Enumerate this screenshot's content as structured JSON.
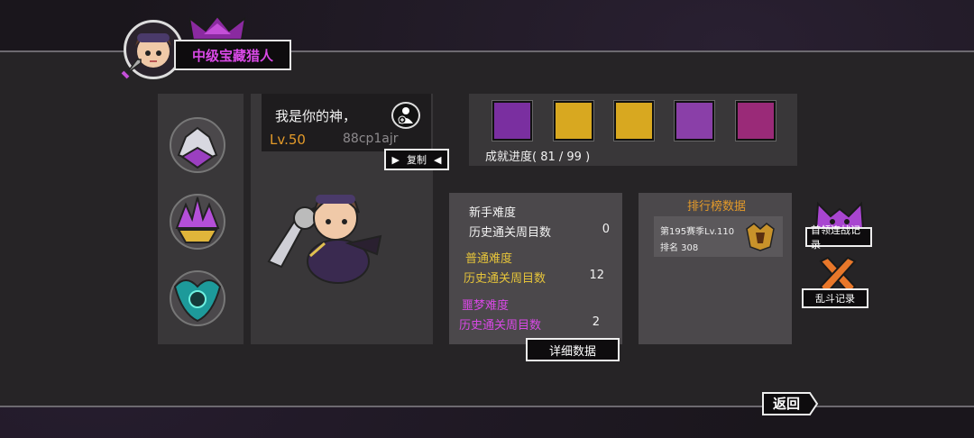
{
  "header": {
    "title": "中级宝藏猎人"
  },
  "medals": [
    {
      "name": "silver-dragon-medal"
    },
    {
      "name": "purple-crystal-medal"
    },
    {
      "name": "teal-emblem-medal"
    }
  ],
  "profile": {
    "nickname": "我是你的神，",
    "level": "Lv.50",
    "uid": "88cp1ajr",
    "copy_label": "复制"
  },
  "achievements": {
    "icons": [
      "purple-reaper-achievement",
      "gold-beast-achievement",
      "gold-warrior-achievement",
      "purple-monster-achievement",
      "pink-dragon-achievement"
    ],
    "progress_label": "成就进度( 81 / 99 )"
  },
  "difficulty": {
    "novice_title": "新手难度",
    "novice_row_label": "历史通关周目数",
    "novice_value": "0",
    "normal_title": "普通难度",
    "normal_row_label": "历史通关周目数",
    "normal_value": "12",
    "nightmare_title": "噩梦难度",
    "nightmare_row_label": "历史通关周目数",
    "nightmare_value": "2",
    "detail_button": "详细数据"
  },
  "ranking": {
    "title": "排行榜数据",
    "season": "第195赛季Lv.110",
    "rank": "排名 308"
  },
  "side_buttons": {
    "boss_streak_label": "首领连战记录",
    "brawl_label": "乱斗记录"
  },
  "back_label": "返回",
  "colors": {
    "accent_purple": "#d949e6",
    "accent_orange": "#e39a2a",
    "panel": "#393739"
  }
}
